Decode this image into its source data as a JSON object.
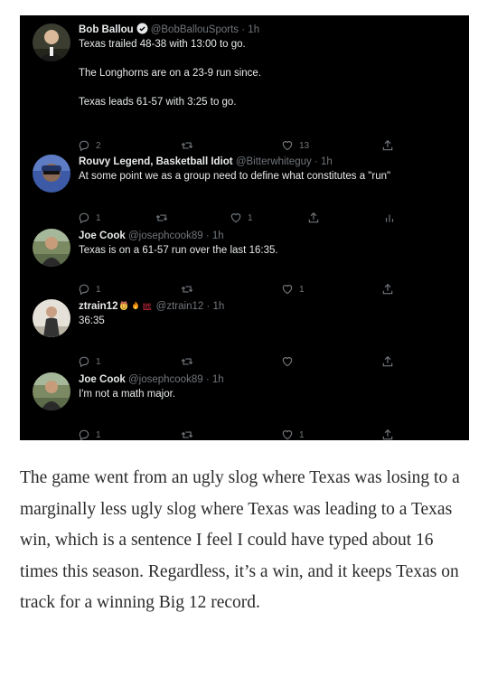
{
  "tweets": [
    {
      "name": "Bob Ballou",
      "handle": "@BobBallouSports",
      "time": "1h",
      "verified": true,
      "paragraphs": [
        "Texas trailed 48-38 with 13:00 to go.",
        "The Longhorns are on a 23-9 run since.",
        "Texas leads 61-57 with 3:25 to go."
      ],
      "replies": "2",
      "retweets": "",
      "likes": "13"
    },
    {
      "name": "Rouvy Legend, Basketball Idiot",
      "handle": "@Bitterwhiteguy",
      "time": "1h",
      "verified": false,
      "paragraphs": [
        "At some point we as a group need to define what constitutes a \"run\""
      ],
      "replies": "1",
      "retweets": "",
      "likes": "1"
    },
    {
      "name": "Joe Cook",
      "handle": "@josephcook89",
      "time": "1h",
      "verified": false,
      "paragraphs": [
        "Texas is on a 61-57 run over the last 16:35."
      ],
      "replies": "1",
      "retweets": "",
      "likes": "1"
    },
    {
      "name": "ztrain12",
      "handle": "@ztrain12",
      "time": "1h",
      "verified": false,
      "emojis": [
        "cowboy-face-emoji",
        "fire-emoji",
        "hundred-points-emoji"
      ],
      "paragraphs": [
        "36:35"
      ],
      "replies": "1",
      "retweets": "",
      "likes": ""
    },
    {
      "name": "Joe Cook",
      "handle": "@josephcook89",
      "time": "1h",
      "verified": false,
      "paragraphs": [
        "I'm not a math major."
      ],
      "replies": "1",
      "retweets": "",
      "likes": "1"
    }
  ],
  "time_separator": "·",
  "icons": {
    "reply": "reply-icon",
    "retweet": "retweet-icon",
    "like": "like-icon",
    "share": "share-icon",
    "analytics": "analytics-icon",
    "verified": "verified-badge-icon"
  },
  "colors": {
    "screenshot_background": "#000000",
    "primary_text": "#e7e9ea",
    "secondary_text": "#71767b",
    "verified_blue": "#1d9bf0",
    "essay_text": "#2b2b2b"
  },
  "essay": {
    "text": "The game went from an ugly slog where Texas was losing to a marginally less ugly slog where Texas was leading to a Texas win, which is a sentence I feel I could have typed about 16 times this season. Regardless, it’s a win, and it keeps Texas on track for a winning Big 12 record."
  }
}
